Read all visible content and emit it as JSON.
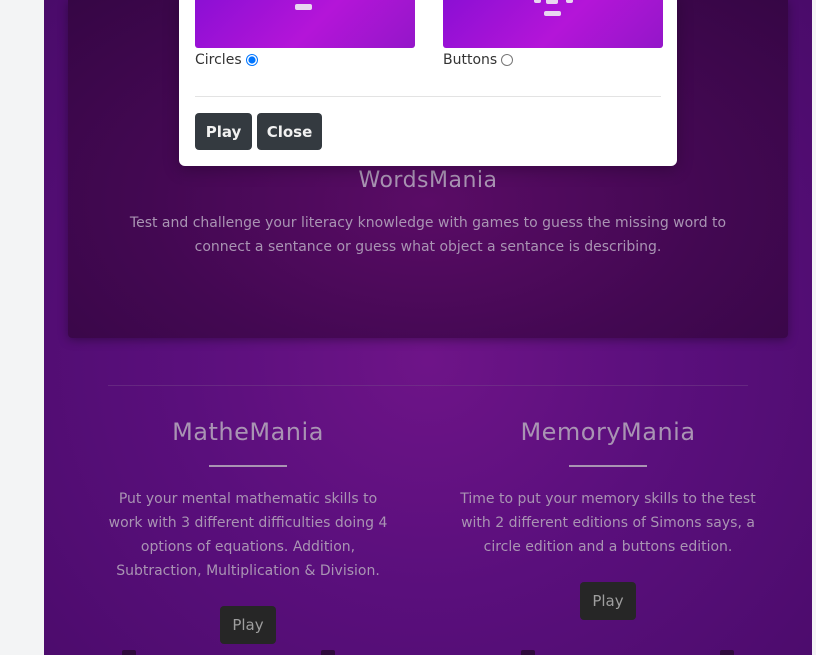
{
  "modal": {
    "options": [
      {
        "label": "Circles",
        "selected": true
      },
      {
        "label": "Buttons",
        "selected": false
      }
    ],
    "play_label": "Play",
    "close_label": "Close"
  },
  "words": {
    "title": "WordsMania",
    "description": "Test and challenge your literacy knowledge with games to guess the missing word to connect a sentance or guess what object a sentance is describing."
  },
  "games": [
    {
      "title": "MatheMania",
      "description": "Put your mental mathematic skills to work with 3 different difficulties doing 4 options of equations. Addition, Subtraction, Multiplication & Division.",
      "play_label": "Play"
    },
    {
      "title": "MemoryMania",
      "description": "Time to put your memory skills to the test with 2 different editions of Simons says, a circle edition and a buttons edition.",
      "play_label": "Play"
    }
  ],
  "colors": {
    "background_purple": "#5a0f7c",
    "card_purple": "#430852",
    "text_muted": "#a994b3",
    "dark_button": "#343a40"
  },
  "footer_icons": [
    "facebook-icon",
    "instagram-icon",
    "github-icon",
    "linkedin-icon"
  ]
}
